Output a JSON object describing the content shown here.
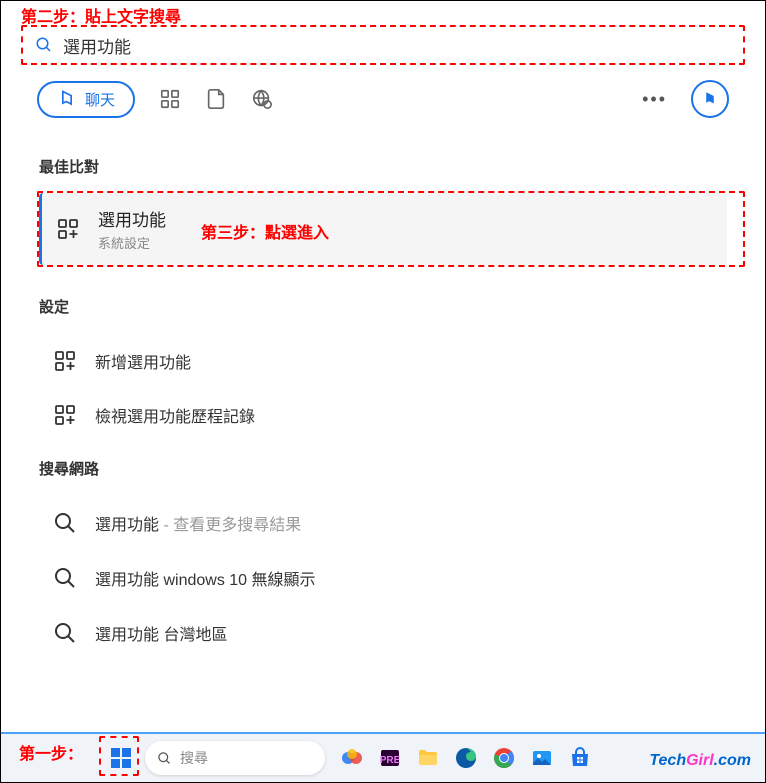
{
  "annotations": {
    "step1": "第一步：",
    "step2": "第二步：貼上文字搜尋",
    "step3": "第三步：點選進入"
  },
  "search": {
    "query": "選用功能"
  },
  "tabs": {
    "chat": "聊天"
  },
  "sections": {
    "best_match": "最佳比對",
    "settings": "設定",
    "search_web": "搜尋網路"
  },
  "best": {
    "title": "選用功能",
    "subtitle": "系統設定"
  },
  "settings_items": [
    {
      "label": "新增選用功能"
    },
    {
      "label": "檢視選用功能歷程記錄"
    }
  ],
  "web_items": [
    {
      "prefix": "選用功能",
      "suffix": " - 查看更多搜尋結果"
    },
    {
      "prefix": "選用功能",
      "suffix": " windows 10 無線顯示"
    },
    {
      "prefix": "選用功能",
      "suffix": " 台灣地區"
    }
  ],
  "taskbar": {
    "search_placeholder": "搜尋"
  },
  "watermark": {
    "p1": "Tech",
    "p2": "Girl",
    "p3": ".com"
  }
}
